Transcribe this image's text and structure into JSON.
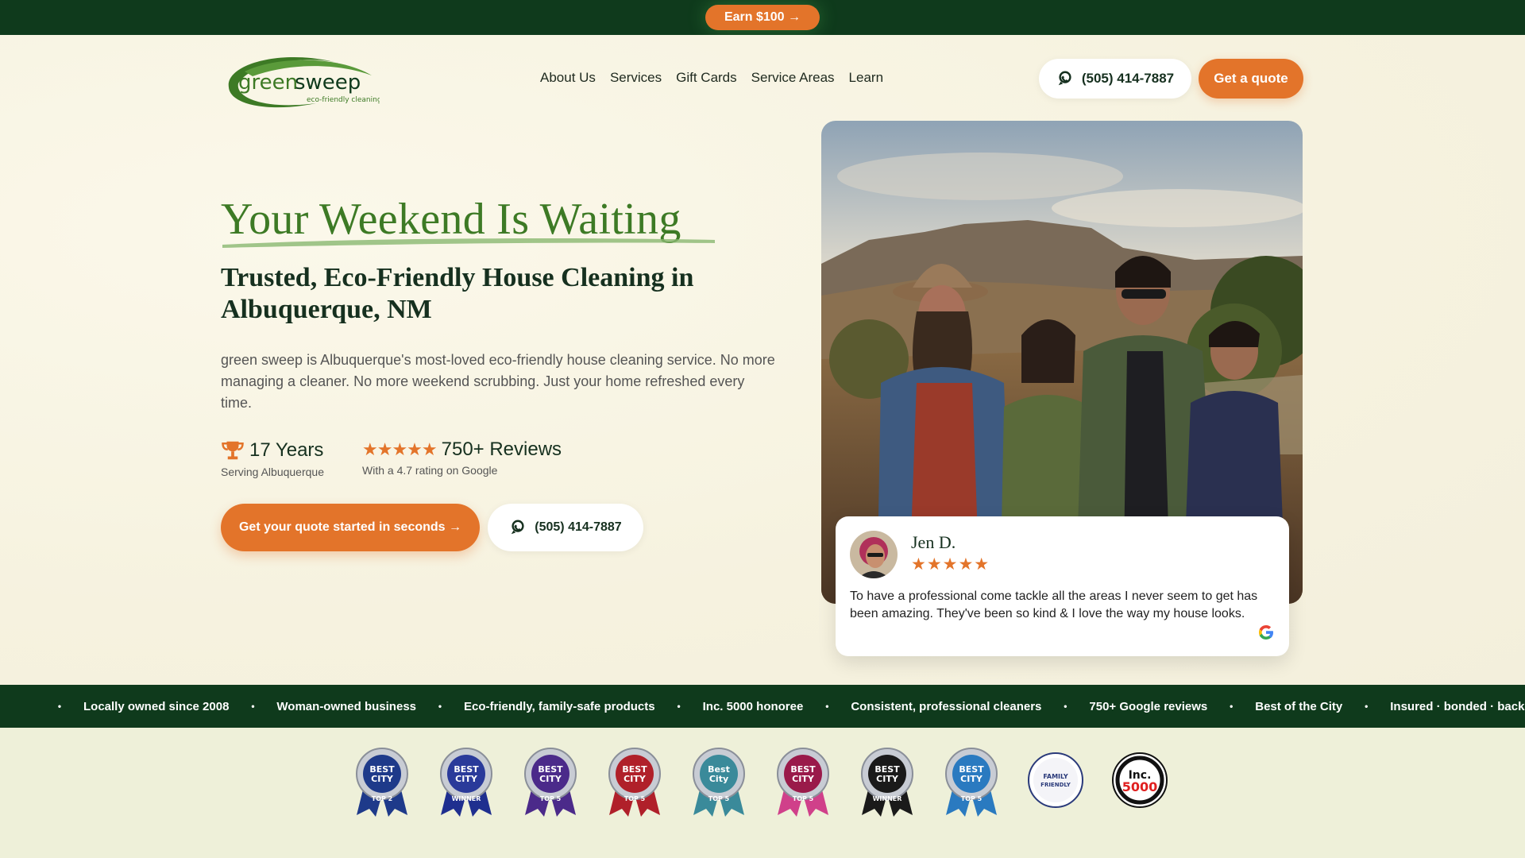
{
  "topbar": {
    "earn_label": "Earn $100 →"
  },
  "brand": {
    "name_green": "green",
    "name_sweep": "sweep",
    "tagline": "eco-friendly cleaning",
    "colors": {
      "green": "#3d7a25",
      "dark": "#0f3a1c",
      "orange": "#e3742a"
    }
  },
  "nav": {
    "items": [
      "About Us",
      "Services",
      "Gift Cards",
      "Service Areas",
      "Learn"
    ]
  },
  "header": {
    "phone": "(505) 414-7887",
    "quote_label": "Get a quote"
  },
  "hero": {
    "title": "Your Weekend Is Waiting",
    "subtitle": "Trusted, Eco-Friendly House Cleaning in Albuquerque, NM",
    "lead": "green sweep is Albuquerque's most-loved eco-friendly house cleaning service. No more managing a cleaner. No more weekend scrubbing. Just your home refreshed every time.",
    "stats": [
      {
        "big": "17 Years",
        "small": "Serving Albuquerque",
        "icon": "trophy-icon"
      },
      {
        "big": "750+ Reviews",
        "small": "With a 4.7 rating on Google",
        "icon": "stars-icon",
        "stars": "★★★★★"
      }
    ],
    "cta_primary": "Get your quote started in seconds →",
    "cta_phone": "(505) 414-7887"
  },
  "review": {
    "name": "Jen D.",
    "stars": "★★★★★",
    "text": "To have a professional come tackle all the areas I never seem to get has been amazing. They've been so kind & I love the way my house looks.",
    "source_icon": "google-icon"
  },
  "ticker": {
    "items": [
      "Locally owned since 2008",
      "Woman-owned business",
      "Eco-friendly, family-safe products",
      "Inc. 5000 honoree",
      "Consistent, professional cleaners",
      "750+ Google reviews",
      "Best of the City",
      "Insured · bonded · background-checked"
    ]
  },
  "badges": [
    {
      "line1": "BEST",
      "line2": "CITY",
      "ribbon": "TOP 2",
      "color": "#1e3a8a",
      "ribbon_color": "#1e3a8a"
    },
    {
      "line1": "BEST",
      "line2": "CITY",
      "ribbon": "WINNER",
      "color": "#2a3a9a",
      "ribbon_color": "#1f2f8f"
    },
    {
      "line1": "BEST",
      "line2": "CITY",
      "ribbon": "TOP 5",
      "color": "#4b2a8a",
      "ribbon_color": "#4b2a8a"
    },
    {
      "line1": "BEST",
      "line2": "CITY",
      "ribbon": "TOP 5",
      "color": "#b0202a",
      "ribbon_color": "#b0202a"
    },
    {
      "line1": "Best",
      "line2": "City",
      "ribbon": "TOP 5",
      "color": "#3a8a9a",
      "ribbon_color": "#3a8a9a"
    },
    {
      "line1": "BEST",
      "line2": "CITY",
      "ribbon": "TOP 5",
      "color": "#9a1a4a",
      "ribbon_color": "#d0408a"
    },
    {
      "line1": "BEST",
      "line2": "CITY",
      "ribbon": "WINNER",
      "color": "#1a1a1a",
      "ribbon_color": "#1a1a1a"
    },
    {
      "line1": "BEST",
      "line2": "CITY",
      "ribbon": "TOP 5",
      "color": "#2a7ac0",
      "ribbon_color": "#2a7ac0"
    },
    {
      "line1": "FAMILY",
      "line2": "FRIENDLY",
      "ribbon": "",
      "color": "#2a3a7a",
      "ribbon_color": ""
    },
    {
      "line1": "Inc.",
      "line2": "5000",
      "ribbon": "",
      "color": "#111111",
      "ribbon_color": ""
    }
  ]
}
